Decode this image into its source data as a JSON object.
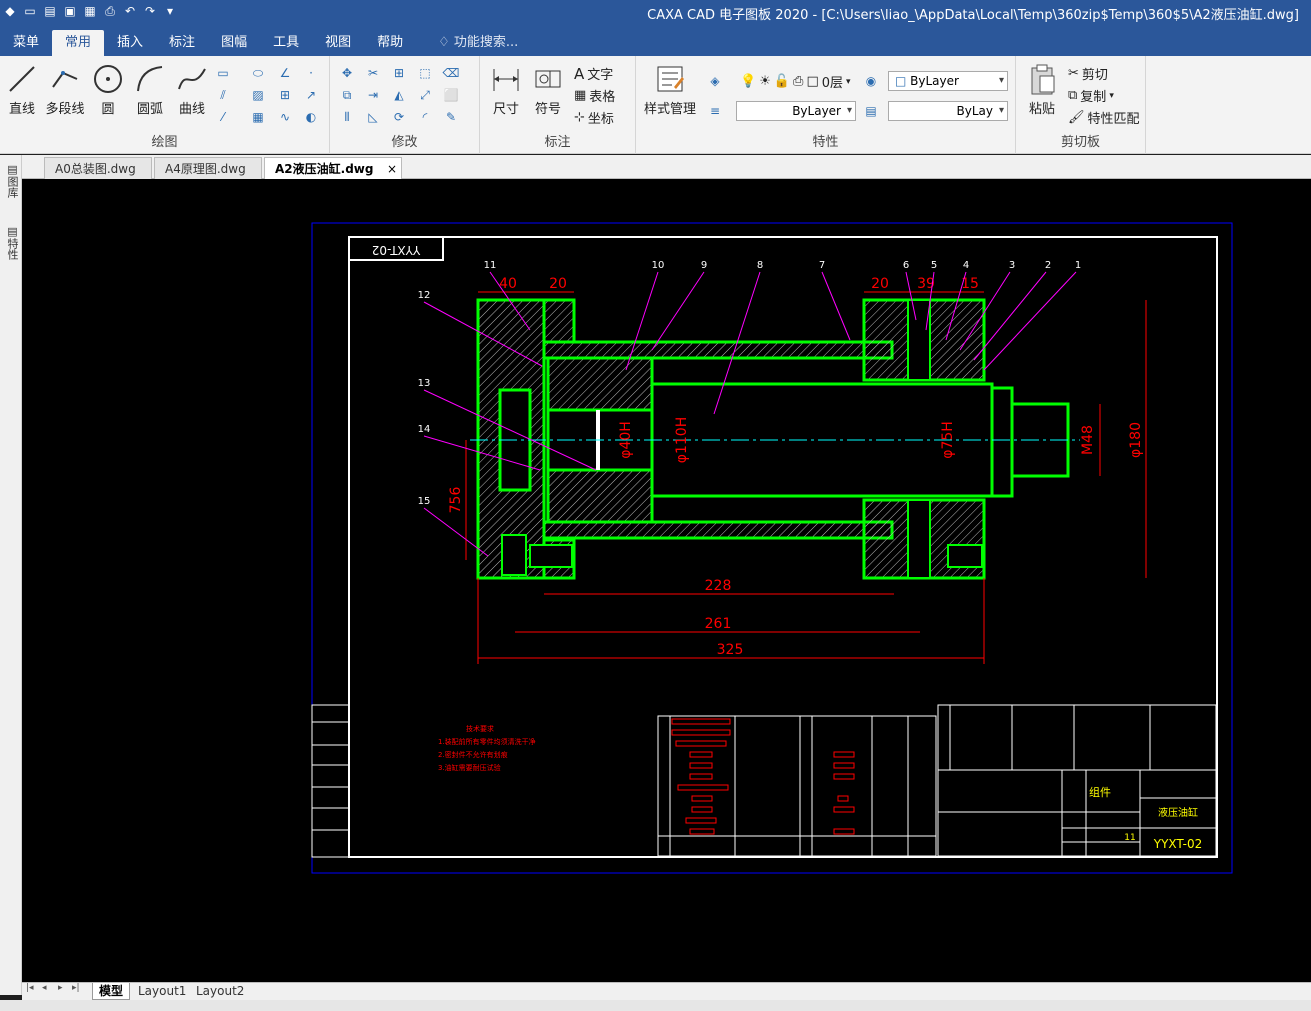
{
  "window": {
    "title": "CAXA CAD 电子图板 2020 - [C:\\Users\\liao_\\AppData\\Local\\Temp\\360zip$Temp\\360$5\\A2液压油缸.dwg]"
  },
  "menu": {
    "items": [
      "菜单",
      "常用",
      "插入",
      "标注",
      "图幅",
      "工具",
      "视图",
      "帮助"
    ],
    "active": "常用",
    "search_placeholder": "功能搜索..."
  },
  "ribbon": {
    "draw": {
      "label": "绘图",
      "tools": [
        "直线",
        "多段线",
        "圆",
        "圆弧",
        "曲线"
      ]
    },
    "modify": {
      "label": "修改"
    },
    "annotate": {
      "label": "标注",
      "tools": [
        "尺寸",
        "符号"
      ],
      "small": [
        "文字",
        "表格",
        "坐标"
      ]
    },
    "properties": {
      "label": "特性",
      "style_manage": "样式管理",
      "layer": "0层",
      "color": "ByLayer",
      "linetype": "ByLayer",
      "lineweight": "ByLay"
    },
    "clipboard": {
      "label": "剪切板",
      "paste": "粘贴",
      "cut": "剪切",
      "copy": "复制",
      "match": "特性匹配"
    }
  },
  "file_tabs": [
    {
      "label": "A0总装图.dwg",
      "active": false
    },
    {
      "label": "A4原理图.dwg",
      "active": false
    },
    {
      "label": "A2液压油缸.dwg",
      "active": true
    }
  ],
  "left_panels": [
    "图库",
    "特性"
  ],
  "layout_tabs": [
    {
      "label": "模型",
      "active": true
    },
    {
      "label": "Layout1",
      "active": false
    },
    {
      "label": "Layout2",
      "active": false
    }
  ],
  "drawing": {
    "drawing_number": "YYXT-02",
    "part_name": "液压油缸",
    "title_block_label": "组件",
    "sheet_count": "11",
    "dims": [
      "40",
      "20",
      "20",
      "39",
      "15",
      "228",
      "261",
      "325",
      "φ40H",
      "φ110H",
      "φ75H",
      "M48",
      "φ180",
      "756"
    ],
    "balloons": [
      "1",
      "2",
      "3",
      "4",
      "5",
      "6",
      "7",
      "8",
      "9",
      "10",
      "11",
      "12",
      "13",
      "14",
      "15"
    ],
    "notes_title": "技术要求",
    "notes": [
      "1.装配前所有零件均须清洗干净",
      "2.密封件不允许有划痕",
      "3.油缸需要耐压试验"
    ]
  },
  "colors": {
    "accent": "#2b579a",
    "canvas": "#000000",
    "outline": "#00ff00",
    "dimension": "#ff0000",
    "text": "#ffffff",
    "leader": "#ff00ff",
    "hatch": "#c0c0c0",
    "border": "#0000ff"
  }
}
